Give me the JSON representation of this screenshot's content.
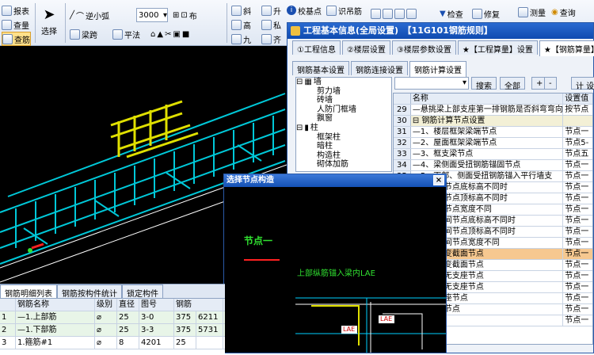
{
  "toolbar": {
    "report": "报表",
    "query": "查量",
    "rebar_view": "查筋",
    "select": "选择",
    "arc_label": "逆小弧",
    "arc_value": "3000",
    "cloth": "布",
    "beam_span": "梁跨",
    "level": "平法",
    "slope": "斜",
    "up": "升",
    "high": "高",
    "private": "私",
    "nine": "九",
    "align": "齐",
    "calibrate": "校基点",
    "identify": "识吊筋",
    "check": "检查",
    "repair": "修复",
    "measure": "测量",
    "lookup": "查询"
  },
  "dialog": {
    "title": "工程基本信息(全局设置)　【11G101钢筋规则】",
    "tabs": [
      "①工程信息",
      "②楼层设置",
      "③楼层参数设置",
      "★【工程算量】设置",
      "★【钢筋算量】设置"
    ],
    "subtabs": [
      "钢筋基本设置",
      "钢筋连接设置",
      "钢筋计算设置"
    ],
    "search_btn": "搜索",
    "all_btn": "全部",
    "plus": "+",
    "minus": "-",
    "calc_btn": "计 设",
    "col_name": "名称",
    "col_value": "设置值",
    "tree": [
      "墙",
      "剪力墙",
      "砖墙",
      "人防门框墙",
      "飘窗",
      "柱",
      "框架柱",
      "暗柱",
      "构造柱",
      "砌体加筋"
    ],
    "rows": [
      {
        "n": "29",
        "name": "—悬挑梁上部支座第一排钢筋是否斜弯弯向下",
        "v": "按节点"
      },
      {
        "n": "30",
        "name": "⊟ 钢筋计算节点设置",
        "v": ""
      },
      {
        "n": "31",
        "name": "—1、楼层框架梁端节点",
        "v": "节点一"
      },
      {
        "n": "32",
        "name": "—2、屋面框架梁端节点",
        "v": "节点5-"
      },
      {
        "n": "33",
        "name": "—3、框支梁节点",
        "v": "节点五"
      },
      {
        "n": "34",
        "name": "—4、梁侧面受扭钢筋锚固节点",
        "v": "节点一"
      },
      {
        "n": "35",
        "name": "—5、下部、侧面受扭钢筋锚入平行墙支",
        "v": "节点一"
      },
      {
        "n": "36",
        "name": "—梁中间节点底标高不同时",
        "v": "节点一"
      },
      {
        "n": "37",
        "name": "—梁中间节点顶标高不同时",
        "v": "节点一"
      },
      {
        "n": "38",
        "name": "—梁中间节点宽度不同",
        "v": "节点一"
      },
      {
        "n": "39",
        "name": "—面梁中间节点底标高不同时",
        "v": "节点一"
      },
      {
        "n": "40",
        "name": "—面梁中间节点顶标高不同时",
        "v": "节点一"
      },
      {
        "n": "41",
        "name": "—面梁中间节点宽度不同",
        "v": "节点一"
      },
      {
        "n": "42",
        "name": "—内上部变截面节点",
        "v": "节点一"
      },
      {
        "n": "43",
        "name": "—内下部变截面节点",
        "v": "节点一"
      },
      {
        "n": "44",
        "name": "—梁阳角无支座节点",
        "v": "节点一"
      },
      {
        "n": "45",
        "name": "—梁阴角无支座节点",
        "v": "节点一"
      },
      {
        "n": "46",
        "name": "—梁端支座节点",
        "v": "节点一"
      },
      {
        "n": "47",
        "name": "—平折梁节点",
        "v": "节点一"
      },
      {
        "n": "48",
        "name": "—梁节点",
        "v": "节点一"
      }
    ]
  },
  "popup": {
    "title": "选择节点构造",
    "node_label": "节点一",
    "desc": "上部纵筋锚入梁内LAE",
    "lae1": "LAE",
    "lae2": "LAE",
    "close": "×"
  },
  "bottom": {
    "tabs": [
      "钢筋明细列表",
      "钢筋按构件统计",
      "锁定构件"
    ],
    "headers": [
      "钢筋名称",
      "级别",
      "直径",
      "图号",
      "钢筋"
    ],
    "rows": [
      {
        "n": "1",
        "name": "—1.上部筋",
        "grade": "⌀",
        "dia": "25",
        "fig": "3-0",
        "len": "375",
        "val": "6211"
      },
      {
        "n": "2",
        "name": "—1.下部筋",
        "grade": "⌀",
        "dia": "25",
        "fig": "3-3",
        "len": "375",
        "val": "5731"
      },
      {
        "n": "3",
        "name": "1.箍筋#1",
        "grade": "⌀",
        "dia": "8",
        "fig": "4201",
        "len": "25",
        "val": ""
      }
    ]
  }
}
